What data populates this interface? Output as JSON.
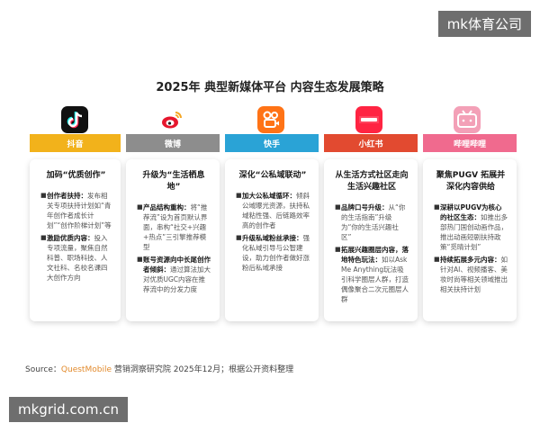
{
  "watermark_top": "mk体育公司",
  "watermark_bottom": "mkgrid.com.cn",
  "title": "2025年 典型新媒体平台 内容生态发展策略",
  "platforms": [
    {
      "name": "抖音",
      "color": "#f2b21b",
      "icon": "douyin-icon",
      "heading": "加码“优质创作”",
      "items": [
        {
          "kw": "创作者扶持：",
          "text": "发布相关专项扶持计划如“青年创作者成长计划”“创作阶梯计划”等"
        },
        {
          "kw": "激励优质内容：",
          "text": "投入专项流量，聚焦自然科普、职场科技、人文社科、名校名课四大创作方向"
        }
      ]
    },
    {
      "name": "微博",
      "color": "#8d8d8d",
      "icon": "weibo-icon",
      "heading": "升级为“生活栖息地”",
      "items": [
        {
          "kw": "产品结构重构：",
          "text": "将“推荐流”设为首页默认界面，串构“社交+兴趣+热点”三引擎推荐模型"
        },
        {
          "kw": "账号资源向中长尾创作者倾斜：",
          "text": "通过算法加大对优质UGC内容在推荐流中的分发力度"
        }
      ]
    },
    {
      "name": "快手",
      "color": "#2aa3d6",
      "icon": "kuaishou-icon",
      "heading": "深化“公私域联动”",
      "items": [
        {
          "kw": "加大公私域循环：",
          "text": "倾斜公域曝光资源，扶持私域粘性强、后链路效率高的创作者"
        },
        {
          "kw": "升级私域粉丝承接：",
          "text": "强化私域引导与公智建设，助力创作者做好涨粉后私域承接"
        }
      ]
    },
    {
      "name": "小红书",
      "color": "#e24a30",
      "icon": "xiaohongshu-icon",
      "heading": "从生活方式社区走向生活兴趣社区",
      "items": [
        {
          "kw": "品牌口号升级：",
          "text": "从“你的生活指南”升级为“你的生活兴趣社区”"
        },
        {
          "kw": "拓展兴趣圈层内容，",
          "text": ""
        },
        {
          "kw": "落地特色玩法：",
          "text": "如以Ask Me Anything玩法吸引科学圈层人群，打造偶像聚合二次元圈层人群"
        }
      ]
    },
    {
      "name": "哔哩哔哩",
      "color": "#f06a8e",
      "icon": "bilibili-icon",
      "heading": "聚焦PUGV 拓展并深化内容供给",
      "items": [
        {
          "kw": "深耕以PUGV为核心的社区生态：",
          "text": "如推出多部热门国创动画作品，推出动画短剧扶持政策“觅晴计划”"
        },
        {
          "kw": "持续拓展多元内容：",
          "text": "如针对AI、视频播客、美妆时尚等相关领域推出相关扶持计划"
        }
      ]
    }
  ],
  "source": {
    "prefix": "Source：",
    "brand": "QuestMobile",
    "rest": " 营销洞察研究院 2025年12月；根据公开资料整理"
  }
}
